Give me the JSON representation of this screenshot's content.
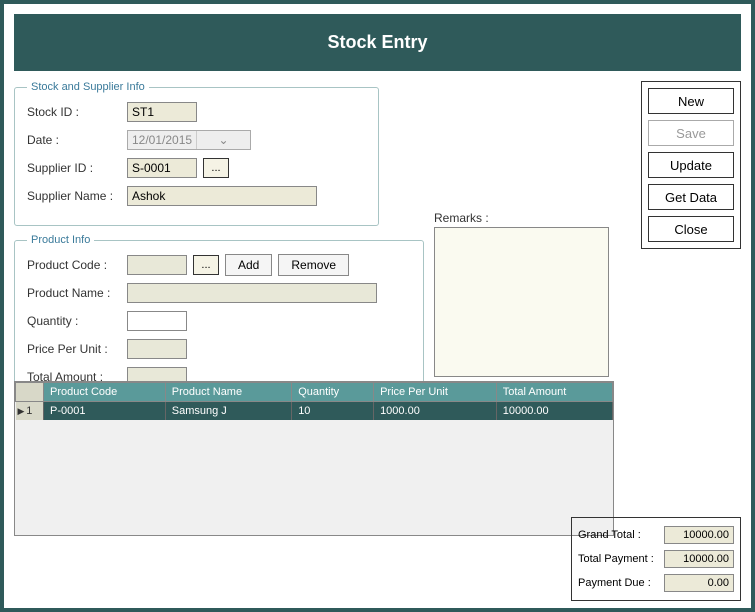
{
  "title": "Stock Entry",
  "stockSection": {
    "legend": "Stock and Supplier Info",
    "stockIdLabel": "Stock ID :",
    "stockId": "ST1",
    "dateLabel": "Date :",
    "date": "12/01/2015",
    "supplierIdLabel": "Supplier ID :",
    "supplierId": "S-0001",
    "browseLabel": "...",
    "supplierNameLabel": "Supplier Name :",
    "supplierName": "Ashok"
  },
  "productSection": {
    "legend": "Product Info",
    "productCodeLabel": "Product Code :",
    "productCode": "",
    "browseLabel": "...",
    "addLabel": "Add",
    "removeLabel": "Remove",
    "productNameLabel": "Product Name :",
    "productName": "",
    "quantityLabel": "Quantity :",
    "quantity": "",
    "priceLabel": "Price Per Unit :",
    "price": "",
    "totalLabel": "Total Amount :",
    "total": ""
  },
  "remarks": {
    "label": "Remarks :",
    "value": ""
  },
  "buttons": {
    "new": "New",
    "save": "Save",
    "update": "Update",
    "getData": "Get Data",
    "close": "Close"
  },
  "grid": {
    "headers": [
      "Product Code",
      "Product Name",
      "Quantity",
      "Price Per Unit",
      "Total Amount"
    ],
    "rows": [
      {
        "num": "1",
        "code": "P-0001",
        "name": "Samsung J",
        "qty": "10",
        "price": "1000.00",
        "total": "10000.00"
      }
    ]
  },
  "totals": {
    "grandTotalLabel": "Grand Total :",
    "grandTotal": "10000.00",
    "totalPaymentLabel": "Total Payment :",
    "totalPayment": "10000.00",
    "paymentDueLabel": "Payment Due :",
    "paymentDue": "0.00"
  }
}
